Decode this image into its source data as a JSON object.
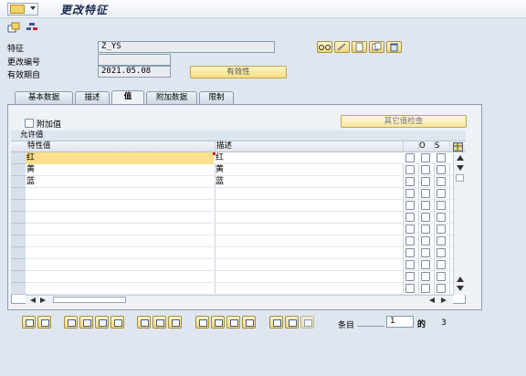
{
  "window": {
    "title": "更改特征"
  },
  "header": {
    "characteristic_label": "特征",
    "characteristic_value": "Z_YS",
    "change_number_label": "更改编号",
    "change_number_value": "",
    "valid_from_label": "有效期自",
    "valid_from_value": "2021.05.08",
    "validity_button": "有效性"
  },
  "tabs": [
    {
      "label": "基本数据"
    },
    {
      "label": "描述"
    },
    {
      "label": "值"
    },
    {
      "label": "附加数据"
    },
    {
      "label": "限制"
    }
  ],
  "panel": {
    "additional_values_label": "附加值",
    "other_value_check_button": "其它值检查",
    "allowed_values_title": "允许值"
  },
  "table": {
    "columns": [
      "特性值",
      "描述",
      "O",
      "S"
    ],
    "rows": [
      {
        "value": "红",
        "description": "红"
      },
      {
        "value": "黄",
        "description": "黄"
      },
      {
        "value": "蓝",
        "description": "蓝"
      }
    ]
  },
  "footer": {
    "entry_label": "条目",
    "entry_value": "1",
    "of_label": "的",
    "total": "3"
  },
  "colors": {
    "background": "#dfe6ef",
    "yellow_button": "#f6df83",
    "highlight_row": "#fde08c"
  }
}
